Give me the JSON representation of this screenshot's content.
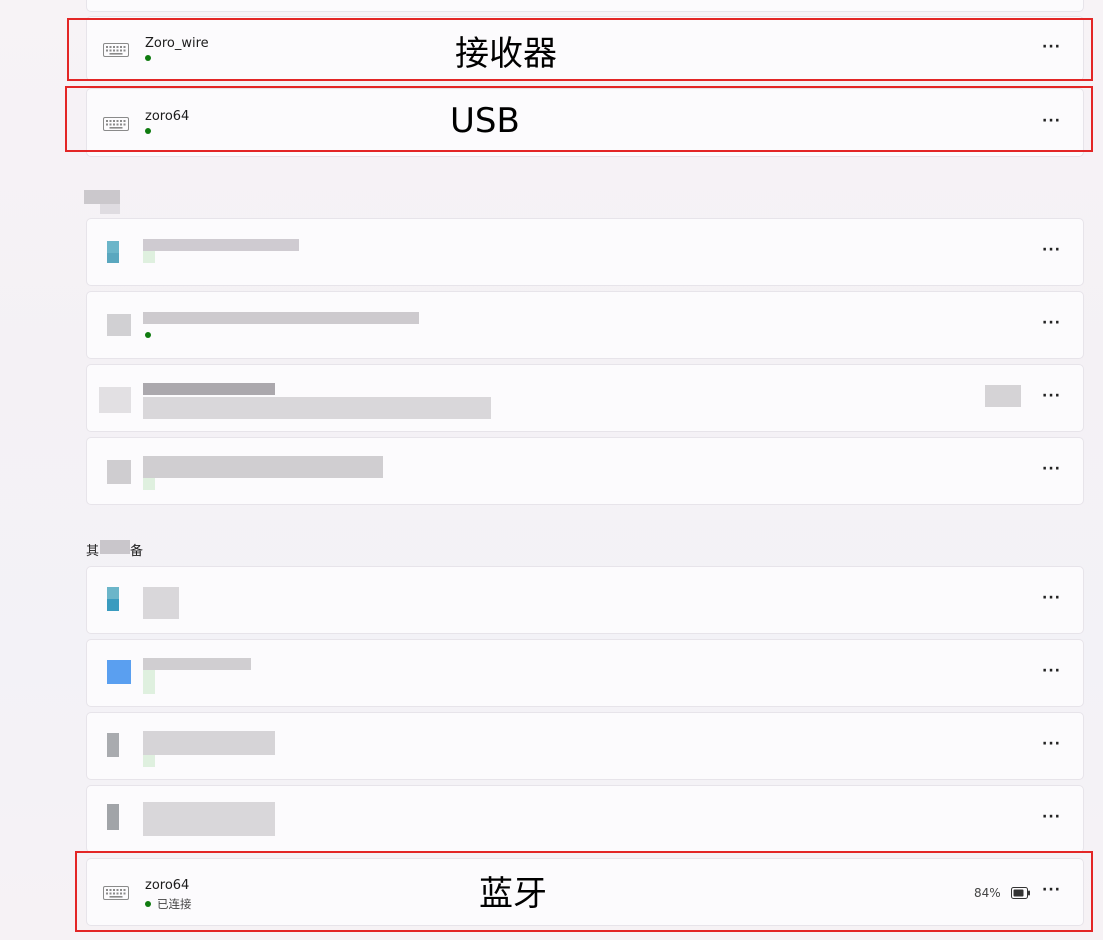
{
  "devices_top": [
    {
      "name": "Zoro_wire",
      "icon": "keyboard-icon"
    },
    {
      "name": "zoro64",
      "icon": "keyboard-icon"
    }
  ],
  "bluetooth_device": {
    "name": "zoro64",
    "status": "已连接",
    "battery": "84%",
    "icon": "keyboard-icon"
  },
  "annotations": {
    "receiver": "接收器",
    "usb": "USB",
    "bluetooth": "蓝牙"
  },
  "section_other_prefix": "其",
  "section_other_suffix": "备",
  "more_label": "···",
  "colors": {
    "connected_dot": "#0f7b0f",
    "annotation_red": "#e32626"
  }
}
